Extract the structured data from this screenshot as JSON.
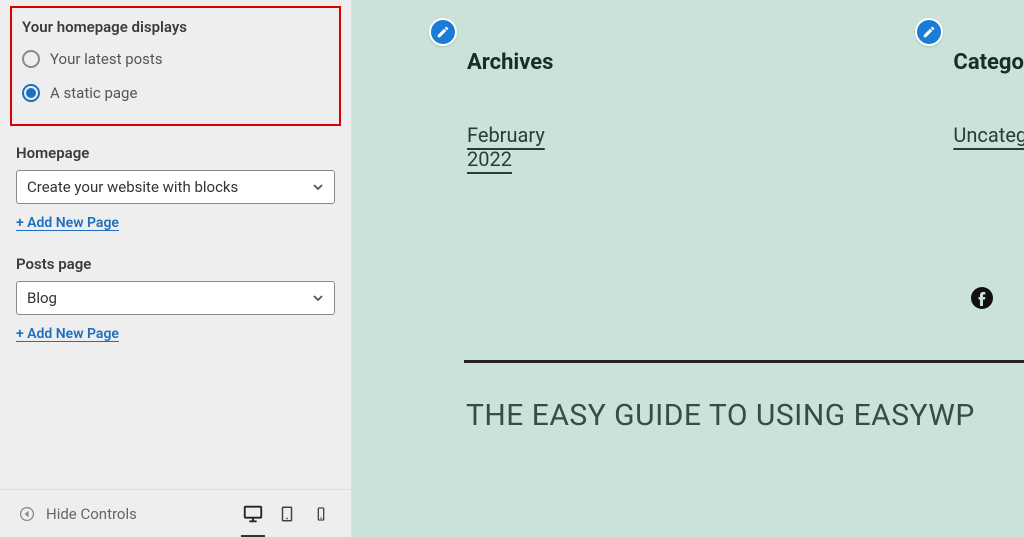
{
  "sidebar": {
    "homepage_section": {
      "title": "Your homepage displays",
      "options": {
        "latest": "Your latest posts",
        "static": "A static page"
      },
      "selected": "static"
    },
    "homepage_field": {
      "label": "Homepage",
      "value": "Create your website with blocks",
      "add_link": "+ Add New Page"
    },
    "posts_page_field": {
      "label": "Posts page",
      "value": "Blog",
      "add_link": "+ Add New Page"
    },
    "footer": {
      "hide_controls": "Hide Controls"
    }
  },
  "preview": {
    "archives": {
      "title": "Archives",
      "link": "February 2022"
    },
    "categories": {
      "title": "Categories",
      "link": "Uncategorized"
    },
    "site_title": "THE EASY GUIDE TO USING EASYWP"
  }
}
